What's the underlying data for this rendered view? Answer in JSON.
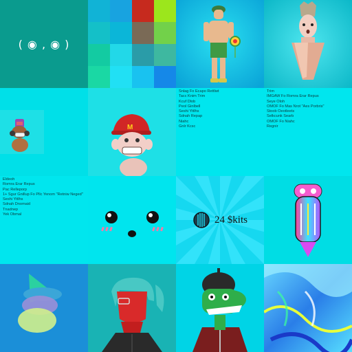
{
  "tiles": {
    "face_text": "( ◉ , ◉ )",
    "mosaic_colors": [
      "#11b3d6",
      "#18a3e0",
      "#c62a1e",
      "#9ce61c",
      "#14c0c8",
      "#0bb6d8",
      "#7a6a56",
      "#72d14a",
      "#13cba2",
      "#22d8e8",
      "#2a9ca8",
      "#3eb8a0",
      "#1ad8a4",
      "#21e0f4",
      "#19c2f0",
      "#1588e8"
    ],
    "list_a": [
      "Snlag Fo Ecapo Rettlwt",
      "Tacc Knim Trim",
      "Kcuf Dlob",
      "Peol Ginlbell",
      "Seshi Yttlhs",
      "Sdnah Repap",
      "Niahc",
      "Gnlr Kcsc"
    ],
    "list_b": [
      "Trim",
      "IMGAW Fo Romra Erar Repus",
      "Seye Oloh",
      "OMOF Fo Mas Nrot \"Aes Porbris\"",
      "Stoob Oeotleets",
      "Selkcunk Searb",
      "OMOF Fo Niahc",
      "Regnir"
    ],
    "list_c": [
      "Eldeoh",
      "Romra Erar Repus",
      "Pac Relleporp",
      "1+ Sgur Gnillup Fo Pllc Yenom \"Retniw Neged\"",
      "Seshi Yttlhs",
      "Sdnah Dnomaid",
      "Tnadnep",
      "Yek Obmal"
    ],
    "kits_label": "24 $kits"
  },
  "colors": {
    "face_bg": "#0a9b8e",
    "cyan": "#00e6ee"
  }
}
